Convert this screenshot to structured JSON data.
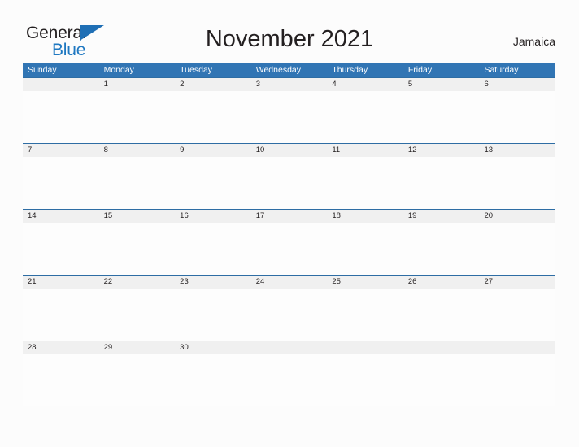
{
  "brand": {
    "name_part1": "General",
    "name_part2": "Blue",
    "flag_icon": "blue-triangle-flag",
    "color_dark": "#231f20",
    "color_blue": "#1f78c1"
  },
  "header": {
    "title": "November 2021",
    "month": "November",
    "year": "2021",
    "locale": "Jamaica"
  },
  "theme": {
    "header_blue": "#3175b4",
    "row_divider_blue": "#2e6da4",
    "date_band_gray": "#f0f0f0",
    "page_background": "#fcfcfc",
    "text_dark": "#231f20"
  },
  "calendar": {
    "weekdays": [
      "Sunday",
      "Monday",
      "Tuesday",
      "Wednesday",
      "Thursday",
      "Friday",
      "Saturday"
    ],
    "weeks": [
      [
        "",
        "1",
        "2",
        "3",
        "4",
        "5",
        "6"
      ],
      [
        "7",
        "8",
        "9",
        "10",
        "11",
        "12",
        "13"
      ],
      [
        "14",
        "15",
        "16",
        "17",
        "18",
        "19",
        "20"
      ],
      [
        "21",
        "22",
        "23",
        "24",
        "25",
        "26",
        "27"
      ],
      [
        "28",
        "29",
        "30",
        "",
        "",
        "",
        ""
      ]
    ]
  }
}
